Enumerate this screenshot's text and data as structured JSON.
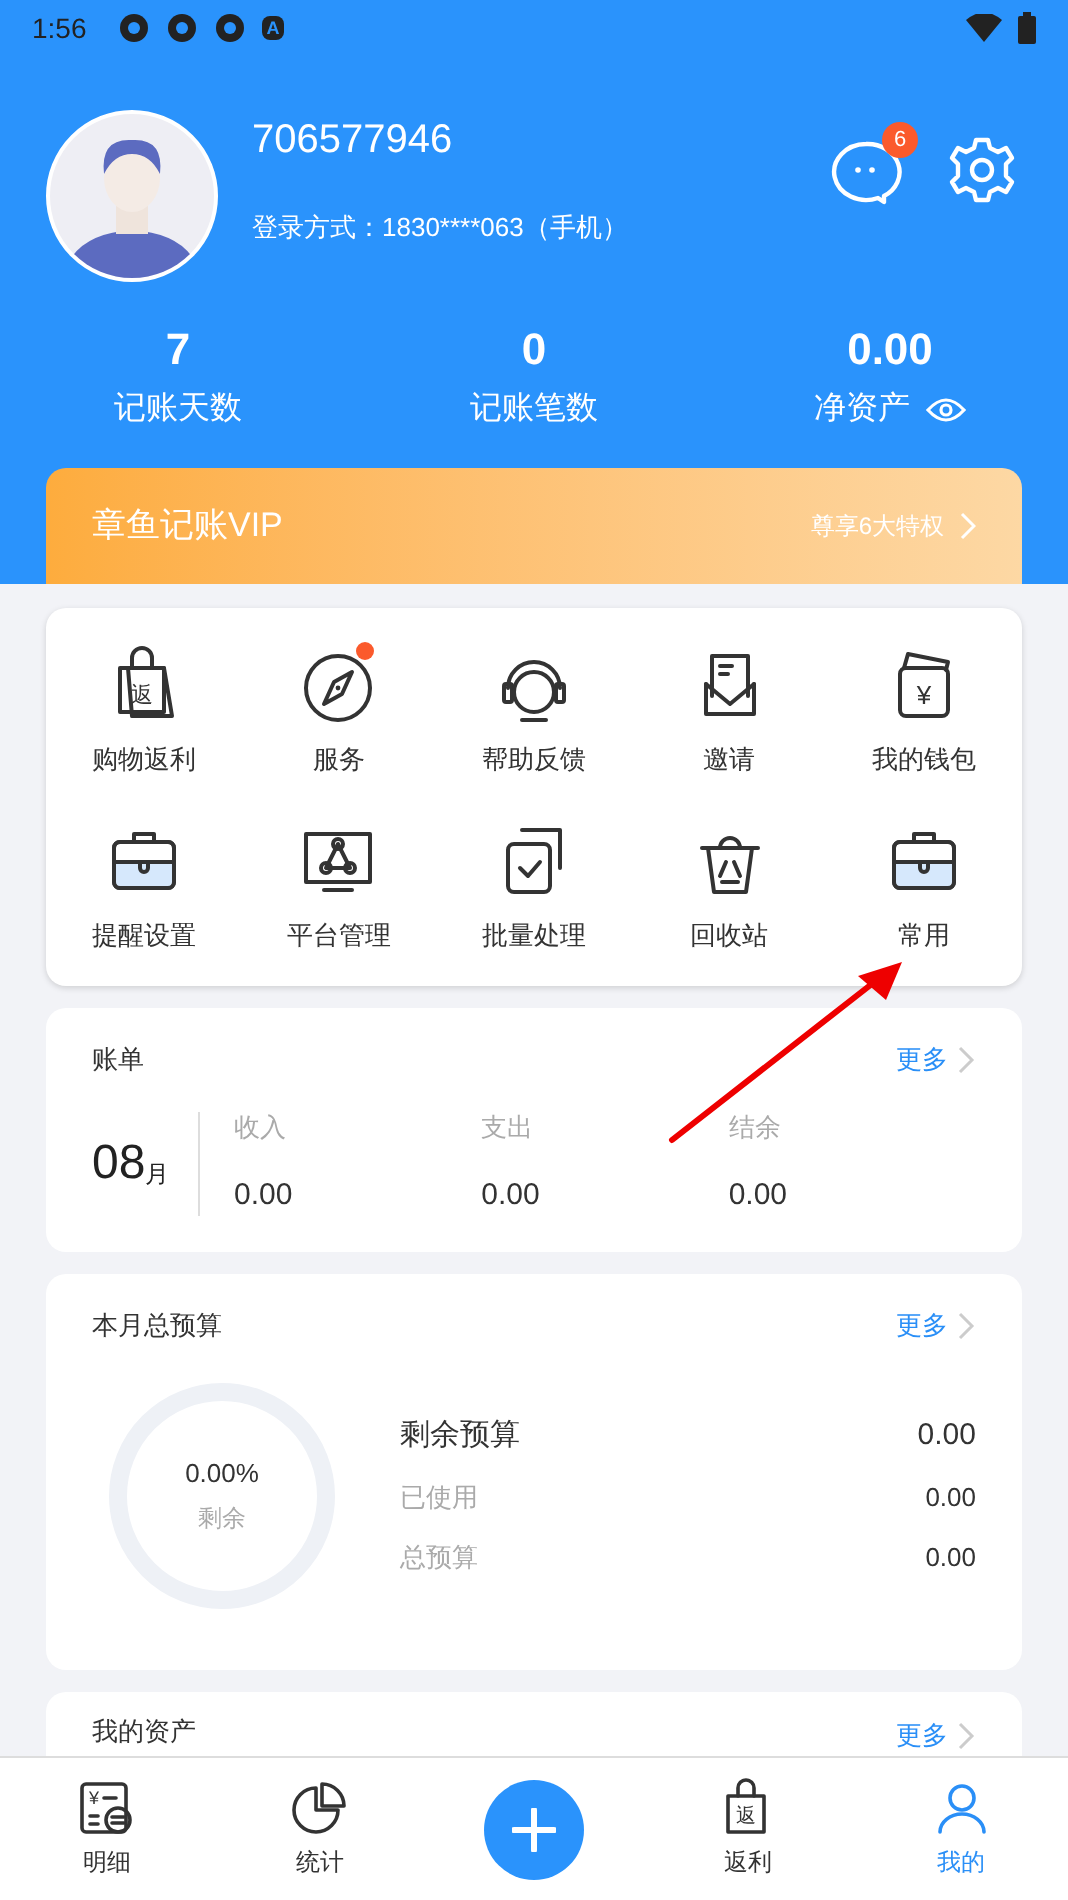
{
  "status_bar": {
    "time": "1:56",
    "letter": "A"
  },
  "profile": {
    "username": "706577946",
    "login": "登录方式：1830****063（手机）",
    "messages_badge": "6"
  },
  "stats": [
    {
      "value": "7",
      "label": "记账天数",
      "eye": false
    },
    {
      "value": "0",
      "label": "记账笔数",
      "eye": false
    },
    {
      "value": "0.00",
      "label": "净资产",
      "eye": true
    }
  ],
  "vip": {
    "title": "章鱼记账VIP",
    "link": "尊享6大特权"
  },
  "shortcuts": [
    {
      "label": "购物返利",
      "kind": "bag",
      "glyph": "返",
      "dot": false
    },
    {
      "label": "服务",
      "kind": "compass",
      "dot": true
    },
    {
      "label": "帮助反馈",
      "kind": "headset",
      "dot": false
    },
    {
      "label": "邀请",
      "kind": "mail",
      "dot": false
    },
    {
      "label": "我的钱包",
      "kind": "wallet",
      "glyph": "¥",
      "dot": false
    },
    {
      "label": "提醒设置",
      "kind": "toolbox",
      "dot": false
    },
    {
      "label": "平台管理",
      "kind": "monitor",
      "dot": false
    },
    {
      "label": "批量处理",
      "kind": "stack",
      "dot": false
    },
    {
      "label": "回收站",
      "kind": "trash",
      "dot": false
    },
    {
      "label": "常用",
      "kind": "toolbox",
      "dot": false
    }
  ],
  "bill": {
    "title": "账单",
    "more": "更多",
    "month": "08",
    "month_unit": "月",
    "columns": [
      {
        "label": "收入",
        "value": "0.00"
      },
      {
        "label": "支出",
        "value": "0.00"
      },
      {
        "label": "结余",
        "value": "0.00"
      }
    ]
  },
  "budget": {
    "title": "本月总预算",
    "more": "更多",
    "percent": "0.00%",
    "percent_label": "剩余",
    "rows": [
      {
        "label": "剩余预算",
        "value": "0.00",
        "kind": "main"
      },
      {
        "label": "已使用",
        "value": "0.00",
        "kind": "sub"
      },
      {
        "label": "总预算",
        "value": "0.00",
        "kind": "sub"
      }
    ]
  },
  "assets": {
    "title": "我的资产",
    "more": "更多"
  },
  "bottom_nav": [
    {
      "label": "明细",
      "kind": "ledger",
      "glyph": "¥",
      "selected": false
    },
    {
      "label": "统计",
      "kind": "pie",
      "selected": false
    },
    {
      "kind": "add"
    },
    {
      "label": "返利",
      "kind": "bag",
      "glyph": "返",
      "selected": false
    },
    {
      "label": "我的",
      "kind": "person",
      "selected": true
    }
  ]
}
